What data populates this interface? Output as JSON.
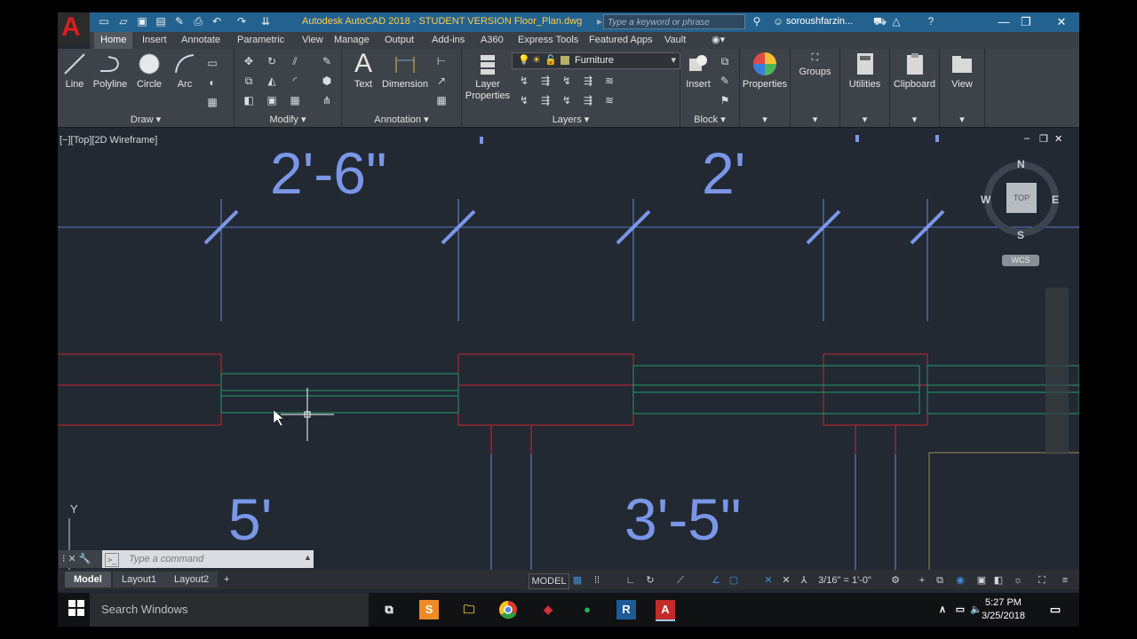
{
  "window": {
    "title": "Autodesk AutoCAD 2018 - STUDENT VERSION    Floor_Plan.dwg",
    "search_placeholder": "Type a keyword or phrase",
    "user": "soroushfarzin..."
  },
  "ribbon_tabs": [
    "Home",
    "Insert",
    "Annotate",
    "Parametric",
    "View",
    "Manage",
    "Output",
    "Add-ins",
    "A360",
    "Express Tools",
    "Featured Apps",
    "Vault"
  ],
  "ribbon": {
    "draw": {
      "title": "Draw",
      "tools": [
        "Line",
        "Polyline",
        "Circle",
        "Arc"
      ]
    },
    "modify": {
      "title": "Modify"
    },
    "annotation": {
      "title": "Annotation",
      "tools": [
        "Text",
        "Dimension"
      ]
    },
    "layers": {
      "title": "Layers",
      "layer_properties": "Layer\nProperties",
      "current_layer": "Furniture"
    },
    "block": {
      "title": "Block",
      "insert": "Insert"
    },
    "properties": "Properties",
    "groups": "Groups",
    "utilities": "Utilities",
    "clipboard": "Clipboard",
    "view": "View"
  },
  "drawing": {
    "view_label": "[−][Top][2D Wireframe]",
    "dimensions": [
      "2'-6\"",
      "2'",
      "5'",
      "3'-5\""
    ],
    "viewcube": {
      "n": "N",
      "s": "S",
      "e": "E",
      "w": "W",
      "top": "TOP",
      "wcs": "WCS"
    },
    "ucs_y": "Y"
  },
  "command_line": {
    "placeholder": "Type a command"
  },
  "layout_tabs": [
    "Model",
    "Layout1",
    "Layout2"
  ],
  "status_bar": {
    "model": "MODEL",
    "scale": "3/16\" = 1'-0\""
  },
  "taskbar": {
    "search": "Search Windows",
    "time": "5:27 PM",
    "date": "3/25/2018"
  },
  "colors": {
    "dimension": "#7a96e6",
    "wall": "#c8262e",
    "window": "#1f9a6a",
    "titlebar": "#23628f"
  }
}
